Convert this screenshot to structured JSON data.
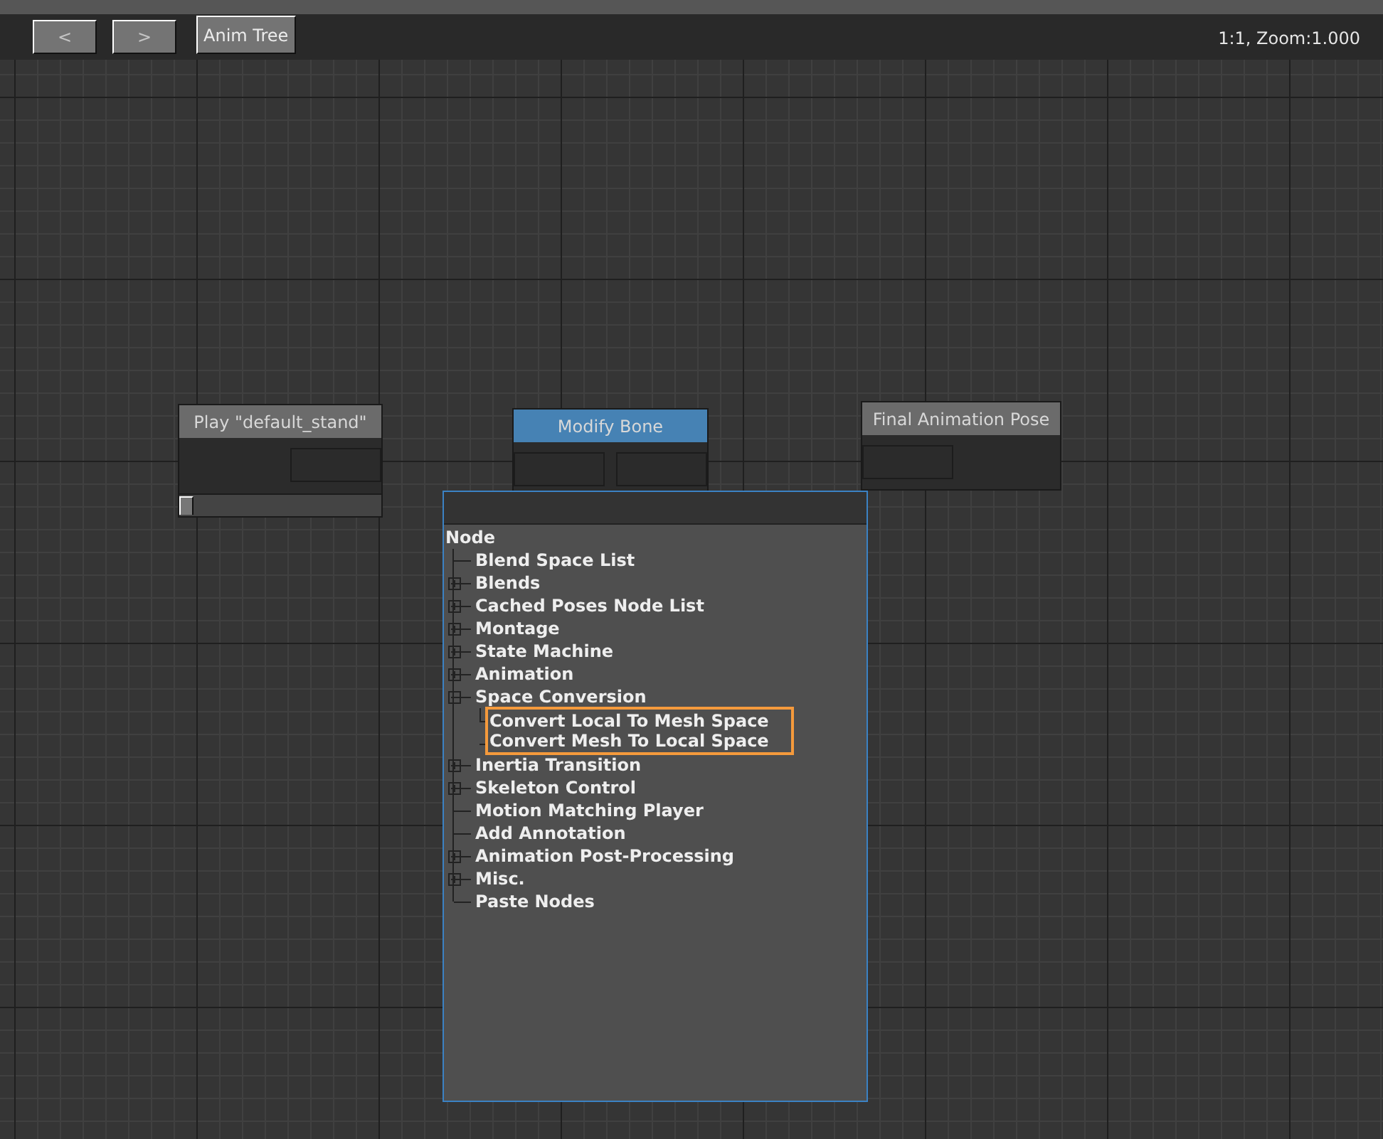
{
  "toolbar": {
    "buttons": [
      {
        "label": "<",
        "disabled": true
      },
      {
        "label": ">",
        "disabled": true
      },
      {
        "label": "Anim Tree",
        "disabled": false
      }
    ],
    "zoom": "1:1, Zoom:1.000"
  },
  "nodes": [
    {
      "title": "Play \"default_stand\"",
      "kind": "player",
      "color": "#6b6b6b",
      "level": 0
    },
    {
      "title": "Modify Bone",
      "kind": "modifier",
      "color": "#4682b4"
    },
    {
      "title": "Final Animation Pose",
      "kind": "output",
      "color": "#6b6b6b"
    }
  ],
  "menu": {
    "root": "Node",
    "items": [
      {
        "label": "Blend Space List",
        "selected": false
      },
      {
        "label": "Blends",
        "expanded": false,
        "selected": false
      },
      {
        "label": "Cached Poses Node List",
        "expanded": false,
        "selected": false
      },
      {
        "label": "Montage",
        "expanded": false,
        "selected": false
      },
      {
        "label": "State Machine",
        "expanded": false,
        "selected": false
      },
      {
        "label": "Animation",
        "expanded": false,
        "selected": false
      },
      {
        "label": "Space Conversion",
        "expanded": true,
        "selected": false,
        "children": [
          {
            "label": "Convert Local To Mesh Space",
            "selected": true
          },
          {
            "label": "Convert Mesh To Local Space",
            "selected": true
          }
        ]
      },
      {
        "label": "Inertia Transition",
        "expanded": false,
        "selected": false
      },
      {
        "label": "Skeleton Control",
        "expanded": false,
        "selected": false
      },
      {
        "label": "Motion Matching Player",
        "selected": false
      },
      {
        "label": "Add Annotation",
        "selected": false
      },
      {
        "label": "Animation Post-Processing",
        "expanded": false,
        "selected": false
      },
      {
        "label": "Misc.",
        "expanded": false,
        "selected": false
      },
      {
        "label": "Paste Nodes",
        "selected": false
      }
    ]
  }
}
